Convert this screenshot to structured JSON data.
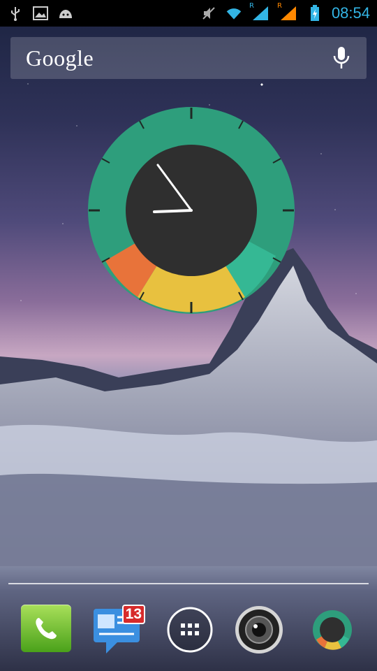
{
  "status_bar": {
    "left_icons": [
      "usb-icon",
      "image-icon",
      "android-icon"
    ],
    "right_icons": [
      "mute-icon",
      "wifi-icon",
      "signal-1-icon",
      "signal-2-icon",
      "battery-charging-icon"
    ],
    "signal_roaming": "R",
    "time": "08:54"
  },
  "search": {
    "logo_text": "Google",
    "voice_icon": "mic-icon"
  },
  "clock_widget": {
    "ring_color": "#2e9e7c",
    "segment_colors": [
      "#e8733a",
      "#e8c13f",
      "#35b894"
    ],
    "face_color": "#2f2f2f"
  },
  "dock": {
    "apps": [
      {
        "name": "phone",
        "icon": "phone-icon"
      },
      {
        "name": "messages",
        "icon": "messages-icon",
        "badge": "13"
      },
      {
        "name": "all-apps",
        "icon": "apps-grid-icon"
      },
      {
        "name": "camera",
        "icon": "camera-icon"
      },
      {
        "name": "clock-app",
        "icon": "ring-icon"
      }
    ]
  }
}
